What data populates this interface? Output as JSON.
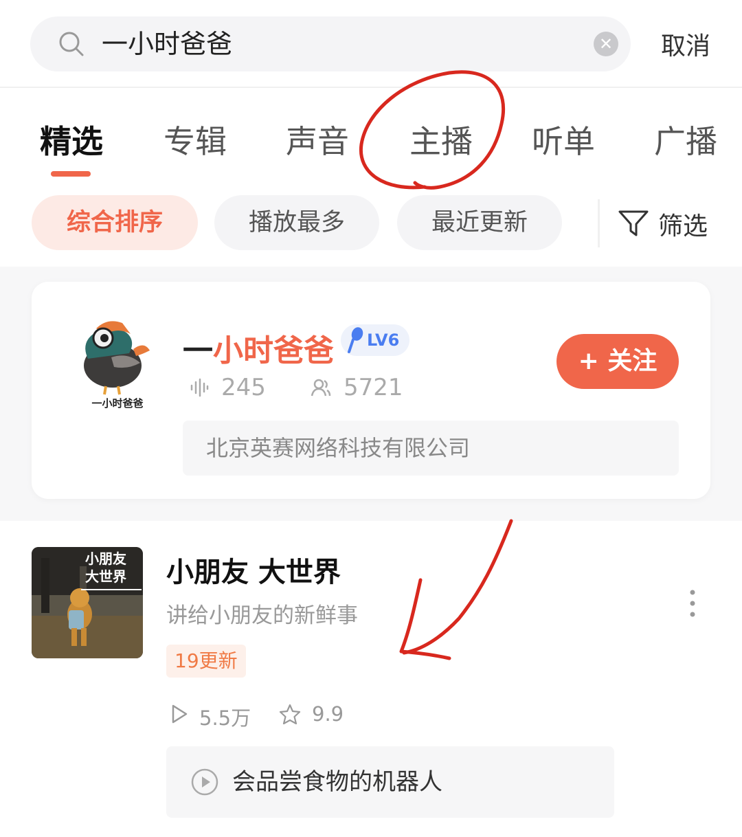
{
  "search": {
    "query": "一小时爸爸",
    "cancel_label": "取消"
  },
  "tabs": [
    {
      "label": "精选",
      "active": true
    },
    {
      "label": "专辑"
    },
    {
      "label": "声音"
    },
    {
      "label": "主播"
    },
    {
      "label": "听单"
    },
    {
      "label": "广播"
    }
  ],
  "sort": {
    "chips": [
      {
        "label": "综合排序",
        "active": true
      },
      {
        "label": "播放最多"
      },
      {
        "label": "最近更新"
      }
    ],
    "filter_label": "筛选"
  },
  "anchor": {
    "name_prefix": "一",
    "name_highlight": "小时爸爸",
    "avatar_caption": "一小时爸爸",
    "level": "LV6",
    "tracks_count": "245",
    "followers_count": "5721",
    "company": "北京英赛网络科技有限公司",
    "follow_label": "+ 关注"
  },
  "album": {
    "cover_text_line1": "小朋友",
    "cover_text_line2": "大世界",
    "title": "小朋友 大世界",
    "subtitle": "讲给小朋友的新鲜事",
    "update_badge": "19更新",
    "plays": "5.5万",
    "rating": "9.9",
    "episode_title": "会品尝食物的机器人"
  },
  "colors": {
    "accent": "#f0664a",
    "annotation": "#d8281e",
    "level_blue": "#4a7df0"
  },
  "icons": {
    "search": "search-icon",
    "clear": "clear-icon",
    "filter": "filter-icon",
    "tracks": "sound-wave-icon",
    "followers": "followers-icon",
    "play": "play-icon",
    "rating": "star-icon",
    "more": "more-vertical-icon"
  }
}
